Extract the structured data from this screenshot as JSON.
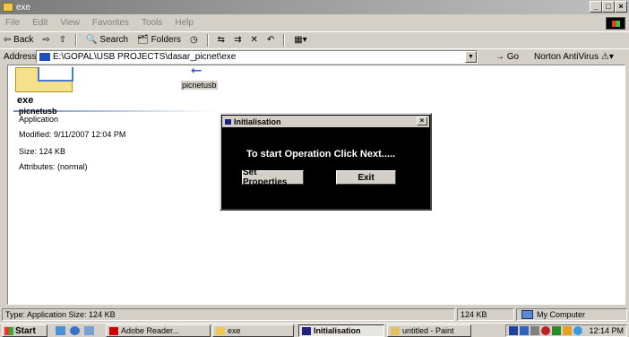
{
  "window": {
    "title": "exe"
  },
  "menu": [
    "File",
    "Edit",
    "View",
    "Favorites",
    "Tools",
    "Help"
  ],
  "toolbar": {
    "back": "⇦ Back",
    "forward": "⇨",
    "search": "Search",
    "folders": "Folders"
  },
  "address": {
    "label": "Address",
    "value": "E:\\GOPAL\\USB PROJECTS\\dasar_picnet\\exe",
    "go": "Go",
    "norton": "Norton AntiVirus"
  },
  "leftpanel": {
    "folder_name": "exe",
    "selected_name": "picnetusb",
    "selected_type": "Application",
    "modified": "Modified: 9/11/2007 12:04 PM",
    "size": "Size: 124 KB",
    "attributes": "Attributes: (normal)"
  },
  "file": {
    "label": "picnetusb"
  },
  "dialog": {
    "title": "Initialisation",
    "message": "To start Operation Click Next.....",
    "set_properties": "Set Properties",
    "exit": "Exit"
  },
  "statusbar": {
    "left": "Type: Application Size: 124 KB",
    "mid": "124 KB",
    "right": "My Computer"
  },
  "taskbar": {
    "start": "Start",
    "tasks": [
      "Adobe Reader...",
      "exe",
      "Initialisation",
      "untitled - Paint"
    ],
    "clock": "12:14 PM"
  }
}
